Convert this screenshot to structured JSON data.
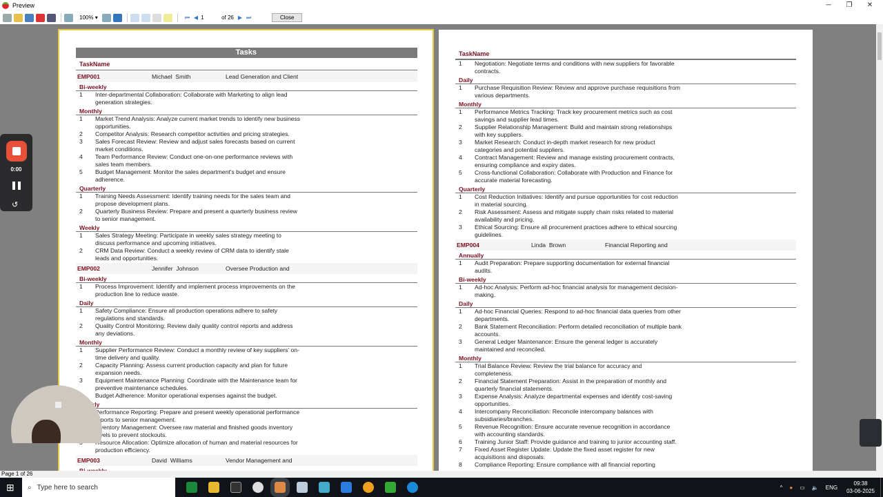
{
  "window": {
    "title": "Preview",
    "minimize": "─",
    "maximize": "❐",
    "close": "✕"
  },
  "toolbar": {
    "zoom": "100%",
    "page": "1",
    "of_pages": "of 26",
    "close_label": "Close"
  },
  "status": "Page 1 of 26",
  "recorder": {
    "time": "0:00"
  },
  "taskbar": {
    "search_placeholder": "Type here to search",
    "language": "ENG",
    "time": "09:38",
    "date": "03-06-2025"
  },
  "report": {
    "title": "Tasks",
    "column_header": "TaskName"
  },
  "page1": [
    {
      "type": "emp",
      "id": "EMP001",
      "first": "Michael",
      "last": "Smith",
      "role": "Lead Generation and Client"
    },
    {
      "type": "group",
      "label": "Bi-weekly"
    },
    {
      "type": "item",
      "n": "1",
      "text": "Inter-departmental Collaboration: Collaborate with Marketing to align lead generation strategies."
    },
    {
      "type": "group",
      "label": "Monthly"
    },
    {
      "type": "item",
      "n": "1",
      "text": "Market Trend Analysis: Analyze current market trends to identify new business opportunities."
    },
    {
      "type": "item",
      "n": "2",
      "text": "Competitor Analysis: Research competitor activities and pricing strategies."
    },
    {
      "type": "item",
      "n": "3",
      "text": "Sales Forecast Review: Review and adjust sales forecasts based on current market conditions."
    },
    {
      "type": "item",
      "n": "4",
      "text": "Team Performance Review: Conduct one-on-one performance reviews with sales team members."
    },
    {
      "type": "item",
      "n": "5",
      "text": "Budget Management: Monitor the sales department's budget and ensure adherence."
    },
    {
      "type": "group",
      "label": "Quarterly"
    },
    {
      "type": "item",
      "n": "1",
      "text": "Training Needs Assessment: Identify training needs for the sales team and propose development plans."
    },
    {
      "type": "item",
      "n": "2",
      "text": "Quarterly Business Review: Prepare and present a quarterly business review to senior management."
    },
    {
      "type": "group",
      "label": "Weekly"
    },
    {
      "type": "item",
      "n": "1",
      "text": "Sales Strategy Meeting: Participate in weekly sales strategy meeting to discuss performance and upcoming initiatives."
    },
    {
      "type": "item",
      "n": "2",
      "text": "CRM Data Review: Conduct a weekly review of CRM data to identify stale leads and opportunities."
    },
    {
      "type": "emp",
      "id": "EMP002",
      "first": "Jennifer",
      "last": "Johnson",
      "role": "Oversee Production and"
    },
    {
      "type": "group",
      "label": "Bi-weekly"
    },
    {
      "type": "item",
      "n": "1",
      "text": "Process Improvement: Identify and implement process improvements on the production line to reduce waste."
    },
    {
      "type": "group",
      "label": "Daily"
    },
    {
      "type": "item",
      "n": "1",
      "text": "Safety Compliance: Ensure all production operations adhere to safety regulations and standards."
    },
    {
      "type": "item",
      "n": "2",
      "text": "Quality Control Monitoring: Review daily quality control reports and address any deviations."
    },
    {
      "type": "group",
      "label": "Monthly"
    },
    {
      "type": "item",
      "n": "1",
      "text": "Supplier Performance Review: Conduct a monthly review of key suppliers' on-time delivery and quality."
    },
    {
      "type": "item",
      "n": "2",
      "text": "Capacity Planning: Assess current production capacity and plan for future expansion needs."
    },
    {
      "type": "item",
      "n": "3",
      "text": "Equipment Maintenance Planning: Coordinate with the Maintenance team for preventive maintenance schedules."
    },
    {
      "type": "item",
      "n": "4",
      "text": "Budget Adherence: Monitor operational expenses against the budget."
    },
    {
      "type": "group",
      "label": "Weekly"
    },
    {
      "type": "item",
      "n": "1",
      "text": "Performance Reporting: Prepare and present weekly operational performance reports to senior management."
    },
    {
      "type": "item",
      "n": "2",
      "text": "Inventory Management: Oversee raw material and finished goods inventory levels to prevent stockouts."
    },
    {
      "type": "item",
      "n": "3",
      "text": "Resource Allocation: Optimize allocation of human and material resources for production efficiency."
    },
    {
      "type": "emp",
      "id": "EMP003",
      "first": "David",
      "last": "Williams",
      "role": "Vendor Management and"
    },
    {
      "type": "group",
      "label": "Bi-weekly"
    }
  ],
  "page2": [
    {
      "type": "item",
      "n": "1",
      "text": "Negotiation: Negotiate terms and conditions with new suppliers for favorable contracts."
    },
    {
      "type": "group",
      "label": "Daily"
    },
    {
      "type": "item",
      "n": "1",
      "text": "Purchase Requisition Review: Review and approve purchase requisitions from various departments."
    },
    {
      "type": "group",
      "label": "Monthly"
    },
    {
      "type": "item",
      "n": "1",
      "text": "Performance Metrics Tracking: Track key procurement metrics such as cost savings and supplier lead times."
    },
    {
      "type": "item",
      "n": "2",
      "text": "Supplier Relationship Management: Build and maintain strong relationships with key suppliers."
    },
    {
      "type": "item",
      "n": "3",
      "text": "Market Research: Conduct in-depth market research for new product categories and potential suppliers."
    },
    {
      "type": "item",
      "n": "4",
      "text": "Contract Management: Review and manage existing procurement contracts, ensuring compliance and expiry dates."
    },
    {
      "type": "item",
      "n": "5",
      "text": "Cross-functional Collaboration: Collaborate with Production and Finance for accurate material forecasting."
    },
    {
      "type": "group",
      "label": "Quarterly"
    },
    {
      "type": "item",
      "n": "1",
      "text": "Cost Reduction Initiatives: Identify and pursue opportunities for cost reduction in material sourcing."
    },
    {
      "type": "item",
      "n": "2",
      "text": "Risk Assessment: Assess and mitigate supply chain risks related to material availability and pricing."
    },
    {
      "type": "item",
      "n": "3",
      "text": "Ethical Sourcing: Ensure all procurement practices adhere to ethical sourcing guidelines."
    },
    {
      "type": "emp",
      "id": "EMP004",
      "first": "Linda",
      "last": "Brown",
      "role": "Financial Reporting and"
    },
    {
      "type": "group",
      "label": "Annually"
    },
    {
      "type": "item",
      "n": "1",
      "text": "Audit Preparation: Prepare supporting documentation for external financial audits."
    },
    {
      "type": "group",
      "label": "Bi-weekly"
    },
    {
      "type": "item",
      "n": "1",
      "text": "Ad-hoc Analysis: Perform ad-hoc financial analysis for management decision-making."
    },
    {
      "type": "group",
      "label": "Daily"
    },
    {
      "type": "item",
      "n": "1",
      "text": "Ad-hoc Financial Queries: Respond to ad-hoc financial data queries from other departments."
    },
    {
      "type": "item",
      "n": "2",
      "text": "Bank Statement Reconciliation: Perform detailed reconciliation of multiple bank accounts."
    },
    {
      "type": "item",
      "n": "3",
      "text": "General Ledger Maintenance: Ensure the general ledger is accurately maintained and reconciled."
    },
    {
      "type": "group",
      "label": "Monthly"
    },
    {
      "type": "item",
      "n": "1",
      "text": "Trial Balance Review: Review the trial balance for accuracy and completeness."
    },
    {
      "type": "item",
      "n": "2",
      "text": "Financial Statement Preparation: Assist in the preparation of monthly and quarterly financial statements."
    },
    {
      "type": "item",
      "n": "3",
      "text": "Expense Analysis: Analyze departmental expenses and identify cost-saving opportunities."
    },
    {
      "type": "item",
      "n": "4",
      "text": "Intercompany Reconciliation: Reconcile intercompany balances with subsidiaries/branches."
    },
    {
      "type": "item",
      "n": "5",
      "text": "Revenue Recognition: Ensure accurate revenue recognition in accordance with accounting standards."
    },
    {
      "type": "item",
      "n": "6",
      "text": "Training Junior Staff: Provide guidance and training to junior accounting staff."
    },
    {
      "type": "item",
      "n": "7",
      "text": "Fixed Asset Register Update: Update the fixed asset register for new acquisitions and disposals."
    },
    {
      "type": "item",
      "n": "8",
      "text": "Compliance Reporting: Ensure compliance with all financial reporting"
    }
  ]
}
